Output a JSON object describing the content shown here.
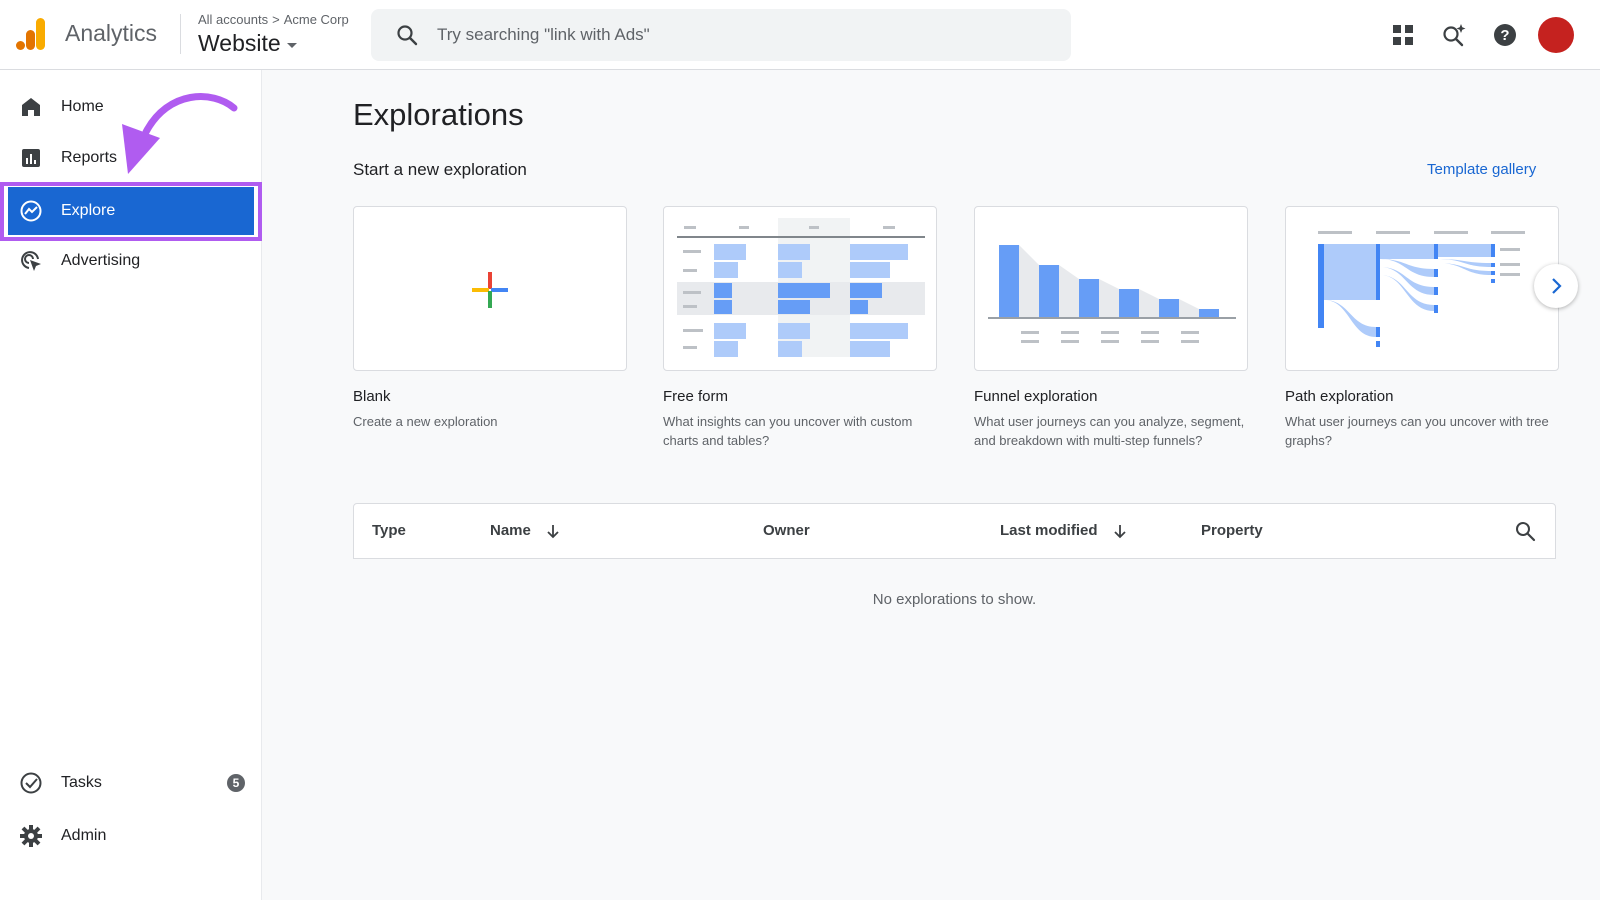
{
  "header": {
    "app_name": "Analytics",
    "breadcrumb": [
      "All accounts",
      "Acme Corp"
    ],
    "breadcrumb_separator": ">",
    "property_name": "Website",
    "search_placeholder": "Try searching \"link with Ads\"",
    "icons": [
      "apps-grid-icon",
      "search-insights-icon",
      "help-icon",
      "avatar"
    ],
    "avatar_color": "#c5221f"
  },
  "sidebar": {
    "items": [
      {
        "label": "Home",
        "icon": "home-icon"
      },
      {
        "label": "Reports",
        "icon": "reports-icon"
      },
      {
        "label": "Explore",
        "icon": "explore-icon",
        "active": true
      },
      {
        "label": "Advertising",
        "icon": "advertising-icon"
      }
    ],
    "bottom_items": [
      {
        "label": "Tasks",
        "icon": "tasks-icon",
        "badge": "5"
      },
      {
        "label": "Admin",
        "icon": "gear-icon"
      }
    ],
    "active_color": "#1967d2",
    "annotation_color": "#b05cf0"
  },
  "main": {
    "title": "Explorations",
    "subtitle": "Start a new exploration",
    "template_gallery": "Template gallery",
    "cards": [
      {
        "title": "Blank",
        "desc": "Create a new exploration"
      },
      {
        "title": "Free form",
        "desc": "What insights can you uncover with custom charts and tables?"
      },
      {
        "title": "Funnel exploration",
        "desc": "What user journeys can you analyze, segment, and breakdown with multi-step funnels?"
      },
      {
        "title": "Path exploration",
        "desc": "What user journeys can you uncover with tree graphs?"
      }
    ],
    "table": {
      "columns": [
        "Type",
        "Name",
        "Owner",
        "Last modified",
        "Property"
      ],
      "empty_text": "No explorations to show."
    }
  }
}
